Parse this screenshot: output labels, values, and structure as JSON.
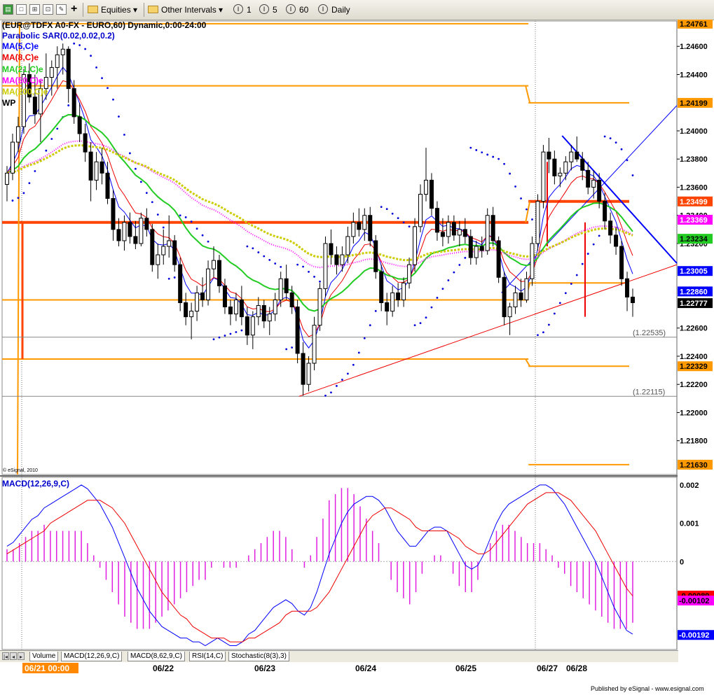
{
  "toolbar": {
    "equities_label": "Equities",
    "other_intervals_label": "Other Intervals",
    "interval_1": "1",
    "interval_5": "5",
    "interval_60": "60",
    "interval_daily": "Daily",
    "circle_glyph": "I"
  },
  "legend": {
    "symbol_line": "(EUR@TDFX A0-FX - EURO,60) Dynamic,0:00-24:00",
    "sar": "Parabolic SAR(0.02,0.02,0.2)",
    "ma5": "MA(5,C)e",
    "ma8": "MA(8,C)e",
    "ma21": "MA(21,C)e",
    "ma50": "MA(50,C)e",
    "ma200": "MA(200,C)e",
    "wp": "WP",
    "copyright": "© eSignal, 2010"
  },
  "macd_legend": "MACD(12,26,9,C)",
  "tabs": [
    "Volume",
    "MACD(12,26,9,C)",
    "MACD(8,62,9,C)",
    "RSI(14,C)",
    "Stochastic(8(3),3)"
  ],
  "footer": "Published by eSignal - www.esignal.com",
  "colors": {
    "pivot": "#ff9900",
    "pivot_main": "#ff4400",
    "ma5": "#0000ff",
    "ma8": "#ee0000",
    "ma21": "#22cc22",
    "ma50": "#ff00ff",
    "ma200": "#cccc00",
    "sar": "#0000dd",
    "macd": "#0000ff",
    "signal": "#ee0000",
    "hist": "#e020e0",
    "trend_blue": "#0000ff",
    "trend_red": "#ee0000",
    "price_box_black": "#000000",
    "price_box_blue": "#0000ff"
  },
  "chart_data": {
    "type": "candlestick",
    "symbol": "EUR@TDFX A0-FX",
    "interval": "60",
    "x_dates": [
      {
        "label": "06/21 00:00",
        "highlight": true
      },
      {
        "label": "06/22",
        "highlight": false
      },
      {
        "label": "06/23",
        "highlight": false
      },
      {
        "label": "06/24",
        "highlight": false
      },
      {
        "label": "06/25",
        "highlight": false
      },
      {
        "label": "06/27",
        "highlight": false
      },
      {
        "label": "06/28",
        "highlight": false
      }
    ],
    "y_ticks": [
      "1.24600",
      "1.24400",
      "1.24000",
      "1.23800",
      "1.23600",
      "1.23400",
      "1.23200",
      "1.22600",
      "1.22400",
      "1.22200",
      "1.22000",
      "1.21800"
    ],
    "ylim": [
      1.2156,
      1.2478
    ],
    "price_boxes": [
      {
        "text": "1.24761",
        "value": 1.24761,
        "bg": "#ff9900",
        "fg": "#000000"
      },
      {
        "text": "1.24199",
        "value": 1.24199,
        "bg": "#ff9900",
        "fg": "#000000"
      },
      {
        "text": "1.23499",
        "value": 1.23499,
        "bg": "#ff4400",
        "fg": "#ffffff"
      },
      {
        "text": "1.23369",
        "value": 1.23369,
        "bg": "#ff00ff",
        "fg": "#ffffff"
      },
      {
        "text": "1.23234",
        "value": 1.23234,
        "bg": "#22cc22",
        "fg": "#000000"
      },
      {
        "text": "1.23005",
        "value": 1.23005,
        "bg": "#0000ff",
        "fg": "#ffffff"
      },
      {
        "text": "1.22860",
        "value": 1.2286,
        "bg": "#0000ff",
        "fg": "#ffffff"
      },
      {
        "text": "1.22777",
        "value": 1.22777,
        "bg": "#000000",
        "fg": "#ffffff"
      },
      {
        "text": "1.22329",
        "value": 1.22329,
        "bg": "#ff9900",
        "fg": "#000000"
      },
      {
        "text": "1.21630",
        "value": 1.2163,
        "bg": "#ff9900",
        "fg": "#000000"
      }
    ],
    "annotations": [
      {
        "text": "(1.22535)",
        "value": 1.22535
      },
      {
        "text": "(1.22115)",
        "value": 1.22115
      }
    ],
    "candles": [
      [
        1.2362,
        1.2375,
        1.235,
        1.237
      ],
      [
        1.237,
        1.2398,
        1.2365,
        1.2392
      ],
      [
        1.2392,
        1.241,
        1.2385,
        1.2403
      ],
      [
        1.2403,
        1.2444,
        1.2398,
        1.244
      ],
      [
        1.244,
        1.2448,
        1.242,
        1.2424
      ],
      [
        1.2424,
        1.244,
        1.2405,
        1.2412
      ],
      [
        1.2412,
        1.2436,
        1.2392,
        1.243
      ],
      [
        1.243,
        1.2455,
        1.2422,
        1.2438
      ],
      [
        1.2438,
        1.245,
        1.2425,
        1.2445
      ],
      [
        1.2445,
        1.246,
        1.243,
        1.2454
      ],
      [
        1.2454,
        1.2462,
        1.244,
        1.2458
      ],
      [
        1.2458,
        1.246,
        1.242,
        1.243
      ],
      [
        1.243,
        1.2436,
        1.2405,
        1.241
      ],
      [
        1.241,
        1.242,
        1.2392,
        1.2398
      ],
      [
        1.2398,
        1.2405,
        1.2378,
        1.2385
      ],
      [
        1.2385,
        1.2392,
        1.235,
        1.2365
      ],
      [
        1.2365,
        1.2385,
        1.2358,
        1.2378
      ],
      [
        1.2378,
        1.2388,
        1.2362,
        1.237
      ],
      [
        1.237,
        1.2378,
        1.2348,
        1.2352
      ],
      [
        1.2352,
        1.2358,
        1.2322,
        1.233
      ],
      [
        1.233,
        1.2338,
        1.2318,
        1.2322
      ],
      [
        1.2322,
        1.234,
        1.2315,
        1.2335
      ],
      [
        1.2335,
        1.2342,
        1.232,
        1.2325
      ],
      [
        1.2325,
        1.2336,
        1.2316,
        1.232
      ],
      [
        1.232,
        1.2342,
        1.2318,
        1.2338
      ],
      [
        1.2338,
        1.2345,
        1.2325,
        1.233
      ],
      [
        1.233,
        1.2334,
        1.23,
        1.2305
      ],
      [
        1.2305,
        1.232,
        1.2295,
        1.2312
      ],
      [
        1.2312,
        1.233,
        1.2305,
        1.2318
      ],
      [
        1.2318,
        1.234,
        1.231,
        1.2322
      ],
      [
        1.2322,
        1.2326,
        1.23,
        1.2305
      ],
      [
        1.2305,
        1.231,
        1.2272,
        1.2278
      ],
      [
        1.2278,
        1.2285,
        1.2262,
        1.2268
      ],
      [
        1.2268,
        1.2278,
        1.2252,
        1.2272
      ],
      [
        1.2272,
        1.229,
        1.2265,
        1.2285
      ],
      [
        1.2285,
        1.2296,
        1.2275,
        1.228
      ],
      [
        1.228,
        1.2308,
        1.2276,
        1.2302
      ],
      [
        1.2302,
        1.2318,
        1.2296,
        1.2308
      ],
      [
        1.2308,
        1.2312,
        1.2285,
        1.229
      ],
      [
        1.229,
        1.2295,
        1.227,
        1.2275
      ],
      [
        1.2275,
        1.228,
        1.2262,
        1.227
      ],
      [
        1.227,
        1.2285,
        1.2265,
        1.228
      ],
      [
        1.228,
        1.229,
        1.2262,
        1.2268
      ],
      [
        1.2268,
        1.2275,
        1.2248,
        1.2255
      ],
      [
        1.2255,
        1.2272,
        1.2245,
        1.2268
      ],
      [
        1.2268,
        1.2282,
        1.2262,
        1.2276
      ],
      [
        1.2276,
        1.228,
        1.226,
        1.2265
      ],
      [
        1.2265,
        1.2275,
        1.2255,
        1.227
      ],
      [
        1.227,
        1.2285,
        1.2265,
        1.228
      ],
      [
        1.228,
        1.23,
        1.2275,
        1.2295
      ],
      [
        1.2295,
        1.2305,
        1.228,
        1.2285
      ],
      [
        1.2285,
        1.229,
        1.227,
        1.2275
      ],
      [
        1.2275,
        1.228,
        1.2235,
        1.2242
      ],
      [
        1.2242,
        1.225,
        1.2212,
        1.222
      ],
      [
        1.222,
        1.224,
        1.2215,
        1.2235
      ],
      [
        1.2235,
        1.2268,
        1.223,
        1.2262
      ],
      [
        1.2262,
        1.2292,
        1.2258,
        1.2288
      ],
      [
        1.2288,
        1.2325,
        1.2282,
        1.232
      ],
      [
        1.232,
        1.233,
        1.2305,
        1.2312
      ],
      [
        1.2312,
        1.2318,
        1.2298,
        1.2305
      ],
      [
        1.2305,
        1.2318,
        1.23,
        1.2312
      ],
      [
        1.2312,
        1.2332,
        1.2306,
        1.2325
      ],
      [
        1.2325,
        1.2342,
        1.232,
        1.2335
      ],
      [
        1.2335,
        1.2345,
        1.2325,
        1.233
      ],
      [
        1.233,
        1.2345,
        1.2322,
        1.234
      ],
      [
        1.234,
        1.2346,
        1.2318,
        1.2322
      ],
      [
        1.2322,
        1.2326,
        1.2295,
        1.23
      ],
      [
        1.23,
        1.2305,
        1.2272,
        1.2278
      ],
      [
        1.2278,
        1.2285,
        1.2262,
        1.2272
      ],
      [
        1.2272,
        1.229,
        1.2268,
        1.2285
      ],
      [
        1.2285,
        1.2292,
        1.2275,
        1.228
      ],
      [
        1.228,
        1.2296,
        1.2275,
        1.2292
      ],
      [
        1.2292,
        1.231,
        1.2288,
        1.2305
      ],
      [
        1.2305,
        1.2338,
        1.23,
        1.2332
      ],
      [
        1.2332,
        1.2362,
        1.2328,
        1.2355
      ],
      [
        1.2355,
        1.2388,
        1.235,
        1.2365
      ],
      [
        1.2365,
        1.237,
        1.234,
        1.2345
      ],
      [
        1.2345,
        1.235,
        1.2322,
        1.2328
      ],
      [
        1.2328,
        1.2338,
        1.2318,
        1.2325
      ],
      [
        1.2325,
        1.234,
        1.232,
        1.2335
      ],
      [
        1.2335,
        1.234,
        1.2322,
        1.2326
      ],
      [
        1.2326,
        1.2336,
        1.2318,
        1.233
      ],
      [
        1.233,
        1.2338,
        1.232,
        1.2325
      ],
      [
        1.2325,
        1.233,
        1.2305,
        1.231
      ],
      [
        1.231,
        1.2322,
        1.2305,
        1.2318
      ],
      [
        1.2318,
        1.2325,
        1.231,
        1.2315
      ],
      [
        1.2315,
        1.2345,
        1.2312,
        1.234
      ],
      [
        1.234,
        1.2346,
        1.2318,
        1.2322
      ],
      [
        1.2322,
        1.2325,
        1.2292,
        1.2296
      ],
      [
        1.2296,
        1.23,
        1.2262,
        1.2268
      ],
      [
        1.2268,
        1.2278,
        1.2255,
        1.2275
      ],
      [
        1.2275,
        1.229,
        1.227,
        1.2285
      ],
      [
        1.2285,
        1.2295,
        1.2275,
        1.228
      ],
      [
        1.228,
        1.23,
        1.2278,
        1.2295
      ],
      [
        1.2295,
        1.2325,
        1.229,
        1.232
      ],
      [
        1.232,
        1.2355,
        1.2315,
        1.235
      ],
      [
        1.235,
        1.239,
        1.2345,
        1.2385
      ],
      [
        1.2385,
        1.2395,
        1.237,
        1.238
      ],
      [
        1.238,
        1.2386,
        1.2362,
        1.2368
      ],
      [
        1.2368,
        1.2374,
        1.236,
        1.237
      ],
      [
        1.237,
        1.2382,
        1.2365,
        1.2378
      ],
      [
        1.2378,
        1.239,
        1.2372,
        1.2385
      ],
      [
        1.2385,
        1.2396,
        1.2378,
        1.238
      ],
      [
        1.238,
        1.2385,
        1.2365,
        1.2372
      ],
      [
        1.2372,
        1.2378,
        1.2355,
        1.236
      ],
      [
        1.236,
        1.2372,
        1.2352,
        1.2365
      ],
      [
        1.2365,
        1.237,
        1.2345,
        1.235
      ],
      [
        1.235,
        1.2356,
        1.233,
        1.2336
      ],
      [
        1.2336,
        1.2342,
        1.232,
        1.2326
      ],
      [
        1.2326,
        1.2332,
        1.2312,
        1.2318
      ],
      [
        1.2318,
        1.2322,
        1.229,
        1.2295
      ],
      [
        1.2295,
        1.23,
        1.2272,
        1.2282
      ],
      [
        1.2282,
        1.2288,
        1.2268,
        1.2278
      ]
    ],
    "moving_averages": [
      {
        "name": "MA(5,C)e",
        "period": 5,
        "color": "#0000ff"
      },
      {
        "name": "MA(8,C)e",
        "period": 8,
        "color": "#ee0000"
      },
      {
        "name": "MA(21,C)e",
        "period": 21,
        "color": "#22cc22"
      },
      {
        "name": "MA(50,C)e",
        "period": 50,
        "color": "#ff00ff",
        "style": "dotted"
      },
      {
        "name": "MA(200,C)e",
        "period": 200,
        "color": "#cccc00",
        "style": "dashed"
      }
    ],
    "pivot_segments": [
      {
        "value": 1.24761,
        "from": 0.0,
        "to": 0.78,
        "main": false
      },
      {
        "value": 1.2432,
        "from": 0.0,
        "to": 0.78,
        "main": false
      },
      {
        "value": 1.24199,
        "from": 0.78,
        "to": 1.0,
        "main": false
      },
      {
        "value": 1.2335,
        "from": 0.0,
        "to": 0.78,
        "main": true
      },
      {
        "value": 1.23499,
        "from": 0.78,
        "to": 1.0,
        "main": true
      },
      {
        "value": 1.228,
        "from": 0.0,
        "to": 0.78,
        "main": false
      },
      {
        "value": 1.2292,
        "from": 0.78,
        "to": 1.0,
        "main": false
      },
      {
        "value": 1.2238,
        "from": 0.0,
        "to": 0.78,
        "main": false
      },
      {
        "value": 1.22329,
        "from": 0.78,
        "to": 1.0,
        "main": false
      },
      {
        "value": 1.2163,
        "from": 0.78,
        "to": 1.0,
        "main": false
      }
    ],
    "ref_lines": [
      1.22535,
      1.22115
    ],
    "trendlines": [
      {
        "color": "#0000ff",
        "width": 2,
        "from": [
          0.83,
          1.23965
        ],
        "to": [
          1.0,
          1.2306
        ]
      },
      {
        "color": "#0000ff",
        "width": 1,
        "from": [
          0.74,
          1.2285
        ],
        "to": [
          1.0,
          1.2418
        ]
      },
      {
        "color": "#ee0000",
        "width": 1,
        "from": [
          0.44,
          1.22115
        ],
        "to": [
          1.0,
          1.2305
        ]
      }
    ],
    "macd": {
      "label": "MACD(12,26,9,C)",
      "ylim": [
        -0.0023,
        0.0022
      ],
      "ticks": [
        "0.002",
        "0.001",
        "0"
      ],
      "boxes": [
        {
          "text": "-0.00089",
          "value": -0.00089,
          "bg": "#ff0000",
          "fg": "#000000"
        },
        {
          "text": "-0.00102",
          "value": -0.00102,
          "bg": "#ff00ff",
          "fg": "#000000"
        },
        {
          "text": "-0.00192",
          "value": -0.00192,
          "bg": "#0000ff",
          "fg": "#ffffff"
        }
      ],
      "macd_values": [
        0.0004,
        0.0005,
        0.0007,
        0.0009,
        0.0011,
        0.0012,
        0.0014,
        0.0015,
        0.0016,
        0.0017,
        0.0018,
        0.0019,
        0.002,
        0.0019,
        0.0017,
        0.0015,
        0.0012,
        0.0009,
        0.0005,
        0.0001,
        -0.0003,
        -0.0007,
        -0.001,
        -0.0013,
        -0.0015,
        -0.0017,
        -0.0018,
        -0.0019,
        -0.002,
        -0.002,
        -0.0021,
        -0.0021,
        -0.0022,
        -0.0021,
        -0.002,
        -0.0021,
        -0.0022,
        -0.0022,
        -0.0021,
        -0.0019,
        -0.0018,
        -0.0016,
        -0.0014,
        -0.0012,
        -0.0011,
        -0.001,
        -0.0011,
        -0.0013,
        -0.0014,
        -0.0012,
        -0.0008,
        -0.0003,
        0.0002,
        0.0006,
        0.001,
        0.0013,
        0.0015,
        0.0016,
        0.0017,
        0.0017,
        0.0016,
        0.0014,
        0.0011,
        0.0008,
        0.0006,
        0.0004,
        0.0004,
        0.0006,
        0.0008,
        0.0009,
        0.0009,
        0.0008,
        0.0005,
        0.0002,
        -0.0001,
        -0.0002,
        -0.0001,
        0.0002,
        0.0006,
        0.001,
        0.0013,
        0.0015,
        0.0016,
        0.0017,
        0.0018,
        0.0019,
        0.002,
        0.002,
        0.0019,
        0.0017,
        0.0015,
        0.0012,
        0.0009,
        0.0006,
        0.0003,
        0.0,
        -0.0004,
        -0.0008,
        -0.0012,
        -0.0015,
        -0.0018,
        -0.0019
      ],
      "signal_values": [
        0.0002,
        0.0003,
        0.0004,
        0.0005,
        0.0006,
        0.0007,
        0.0008,
        0.001,
        0.0011,
        0.0012,
        0.0013,
        0.0014,
        0.0015,
        0.0016,
        0.0016,
        0.0016,
        0.0015,
        0.0014,
        0.0012,
        0.001,
        0.0007,
        0.0004,
        0.0001,
        -0.0002,
        -0.0005,
        -0.0008,
        -0.001,
        -0.0012,
        -0.0014,
        -0.0015,
        -0.0017,
        -0.0018,
        -0.0019,
        -0.002,
        -0.002,
        -0.002,
        -0.0021,
        -0.0021,
        -0.0021,
        -0.002,
        -0.002,
        -0.0019,
        -0.0018,
        -0.0017,
        -0.0016,
        -0.0014,
        -0.0013,
        -0.0013,
        -0.0013,
        -0.0013,
        -0.0012,
        -0.001,
        -0.0008,
        -0.0005,
        -0.0002,
        0.0001,
        0.0004,
        0.0007,
        0.001,
        0.0012,
        0.0013,
        0.0014,
        0.0014,
        0.0013,
        0.0012,
        0.0011,
        0.0009,
        0.0008,
        0.0008,
        0.0008,
        0.0008,
        0.0008,
        0.0007,
        0.0006,
        0.0004,
        0.0003,
        0.0002,
        0.0002,
        0.0003,
        0.0005,
        0.0007,
        0.0009,
        0.0011,
        0.0013,
        0.0015,
        0.0016,
        0.0017,
        0.0018,
        0.0018,
        0.0018,
        0.0017,
        0.0016,
        0.0014,
        0.0012,
        0.001,
        0.0008,
        0.0005,
        0.0002,
        -0.0001,
        -0.0004,
        -0.0007,
        -0.0009
      ]
    }
  }
}
